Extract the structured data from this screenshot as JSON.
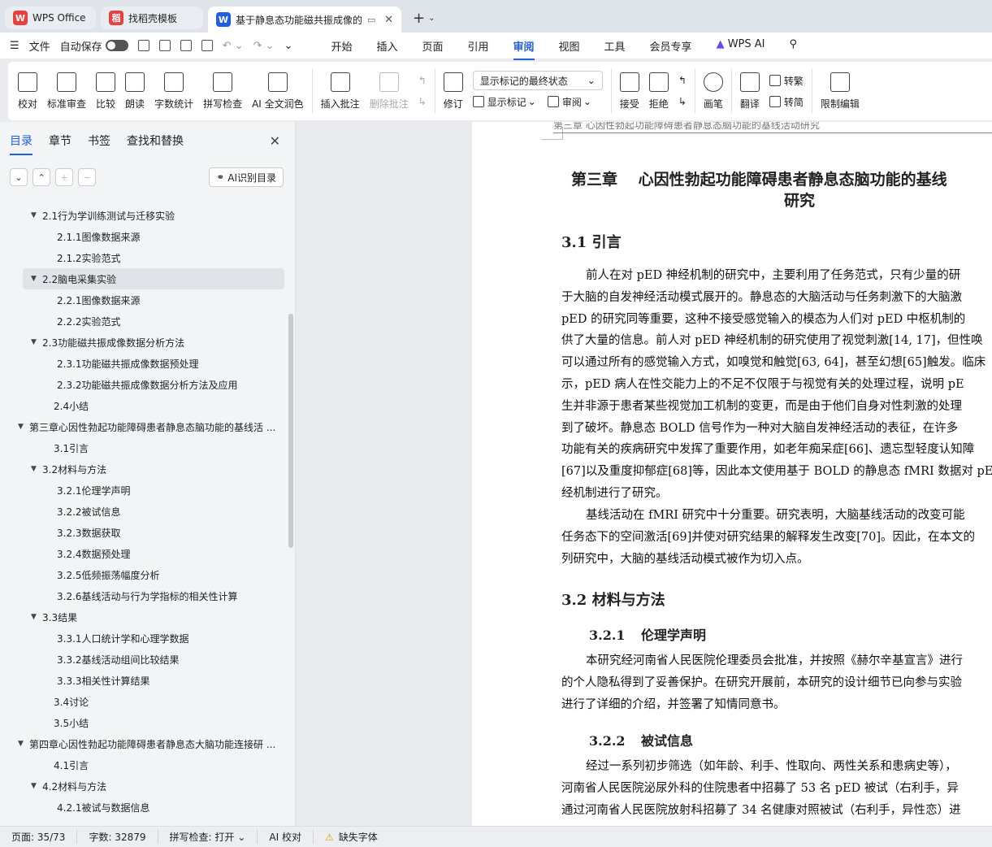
{
  "tabs": [
    {
      "label": "WPS Office",
      "logo": "W",
      "color": "#e8403a"
    },
    {
      "label": "找稻壳模板",
      "logo": "稻",
      "color": "#e8403a"
    },
    {
      "label": "基于静息态功能磁共振成像的",
      "logo": "W",
      "color": "#1f5fe0"
    }
  ],
  "menu": {
    "file": "文件",
    "autosave": "自动保存",
    "main_tabs": [
      "开始",
      "插入",
      "页面",
      "引用",
      "审阅",
      "视图",
      "工具",
      "会员专享"
    ],
    "active_tab": "审阅",
    "wps_ai": "WPS AI"
  },
  "ribbon": {
    "proofread": "校对",
    "std_review": "标准审查",
    "compare": "比较",
    "read_aloud": "朗读",
    "word_count": "字数统计",
    "spell_check": "拼写检查",
    "ai_polish": "AI 全文润色",
    "insert_comment": "插入批注",
    "delete_comment": "删除批注",
    "revise": "修订",
    "markup_select": "显示标记的最终状态",
    "show_markup": "显示标记",
    "review": "审阅",
    "accept": "接受",
    "reject": "拒绝",
    "pen": "画笔",
    "translate": "翻译",
    "to_traditional": "转繁",
    "to_simplified": "转简",
    "restrict_edit": "限制编辑"
  },
  "left_panel": {
    "tabs": [
      "目录",
      "章节",
      "书签",
      "查找和替换"
    ],
    "ai_toc": "AI识别目录",
    "toc": [
      {
        "level": 2,
        "arrow": "▼",
        "text": "2.1行为学训练测试与迁移实验"
      },
      {
        "level": 3,
        "arrow": "",
        "text": "2.1.1图像数据来源"
      },
      {
        "level": 3,
        "arrow": "",
        "text": "2.1.2实验范式"
      },
      {
        "level": 2,
        "arrow": "▼",
        "text": "2.2脑电采集实验",
        "selected": true
      },
      {
        "level": 3,
        "arrow": "",
        "text": "2.2.1图像数据来源"
      },
      {
        "level": 3,
        "arrow": "",
        "text": "2.2.2实验范式"
      },
      {
        "level": 2,
        "arrow": "▼",
        "text": "2.3功能磁共振成像数据分析方法"
      },
      {
        "level": 3,
        "arrow": "",
        "text": "2.3.1功能磁共振成像数据预处理"
      },
      {
        "level": 3,
        "arrow": "",
        "text": "2.3.2功能磁共振成像数据分析方法及应用"
      },
      {
        "level": 2,
        "arrow": "",
        "text": "2.4小结"
      },
      {
        "level": 1,
        "arrow": "▼",
        "text": "第三章心因性勃起功能障碍患者静息态脑功能的基线活 ..."
      },
      {
        "level": 2,
        "arrow": "",
        "text": "3.1引言"
      },
      {
        "level": 2,
        "arrow": "▼",
        "text": "3.2材料与方法"
      },
      {
        "level": 3,
        "arrow": "",
        "text": "3.2.1伦理学声明"
      },
      {
        "level": 3,
        "arrow": "",
        "text": "3.2.2被试信息"
      },
      {
        "level": 3,
        "arrow": "",
        "text": "3.2.3数据获取"
      },
      {
        "level": 3,
        "arrow": "",
        "text": "3.2.4数据预处理"
      },
      {
        "level": 3,
        "arrow": "",
        "text": "3.2.5低频振荡幅度分析"
      },
      {
        "level": 3,
        "arrow": "",
        "text": "3.2.6基线活动与行为学指标的相关性计算"
      },
      {
        "level": 2,
        "arrow": "▼",
        "text": "3.3结果"
      },
      {
        "level": 3,
        "arrow": "",
        "text": "3.3.1人口统计学和心理学数据"
      },
      {
        "level": 3,
        "arrow": "",
        "text": "3.3.2基线活动组间比较结果"
      },
      {
        "level": 3,
        "arrow": "",
        "text": "3.3.3相关性计算结果"
      },
      {
        "level": 2,
        "arrow": "",
        "text": "3.4讨论"
      },
      {
        "level": 2,
        "arrow": "",
        "text": "3.5小结"
      },
      {
        "level": 1,
        "arrow": "▼",
        "text": "第四章心因性勃起功能障碍患者静息态大脑功能连接研 ..."
      },
      {
        "level": 2,
        "arrow": "",
        "text": "4.1引言"
      },
      {
        "level": 2,
        "arrow": "▼",
        "text": "4.2材料与方法"
      },
      {
        "level": 3,
        "arrow": "",
        "text": "4.2.1被试与数据信息"
      }
    ]
  },
  "doc": {
    "running_header": "第三章 心因性勃起功能障碍患者静息态脑功能的基线活动研究",
    "chapter_title_1": "第三章　 心因性勃起功能障碍患者静息态脑功能的基线",
    "chapter_title_2": "研究",
    "h_31": "3.1 引言",
    "p1": [
      "前人在对 pED 神经机制的研究中，主要利用了任务范式，只有少量的研",
      "于大脑的自发神经活动模式展开的。静息态的大脑活动与任务刺激下的大脑激",
      "pED 的研究同等重要，这种不接受感觉输入的模态为人们对 pED 中枢机制的",
      "供了大量的信息。前人对 pED 神经机制的研究使用了视觉刺激[14, 17]，但性唤",
      "可以通过所有的感觉输入方式，如嗅觉和触觉[63, 64]，甚至幻想[65]触发。临床",
      "示，pED 病人在性交能力上的不足不仅限于与视觉有关的处理过程，说明 pE",
      "生并非源于患者某些视觉加工机制的变更，而是由于他们自身对性刺激的处理",
      "到了破坏。静息态 BOLD 信号作为一种对大脑自发神经活动的表征，在许多",
      "功能有关的疾病研究中发挥了重要作用，如老年痴呆症[66]、遗忘型轻度认知障",
      "[67]以及重度抑郁症[68]等，因此本文使用基于 BOLD 的静息态 fMRI 数据对 pE",
      "经机制进行了研究。"
    ],
    "p2": [
      "基线活动在 fMRI 研究中十分重要。研究表明，大脑基线活动的改变可能",
      "任务态下的空间激活[69]并使对研究结果的解释发生改变[70]。因此，在本文的",
      "列研究中，大脑的基线活动模式被作为切入点。"
    ],
    "h_32": "3.2 材料与方法",
    "h_321_num": "3.2.1",
    "h_321_text": "伦理学声明",
    "p3": [
      "本研究经河南省人民医院伦理委员会批准，并按照《赫尔辛基宣言》进行",
      "的个人隐私得到了妥善保护。在研究开展前，本研究的设计细节已向参与实验",
      "进行了详细的介绍，并签署了知情同意书。"
    ],
    "h_322_num": "3.2.2",
    "h_322_text": "被试信息",
    "p4": [
      "经过一系列初步筛选（如年龄、利手、性取向、两性关系和患病史等），",
      "河南省人民医院泌尿外科的住院患者中招募了 53 名 pED 被试（右利手，异",
      "通过河南省人民医院放射科招募了 34 名健康对照被试（右利手，异性恋）进"
    ]
  },
  "status": {
    "page": "页面: 35/73",
    "words": "字数: 32879",
    "spell": "拼写检查: 打开",
    "ai_proof": "AI 校对",
    "missing_font": "缺失字体"
  }
}
